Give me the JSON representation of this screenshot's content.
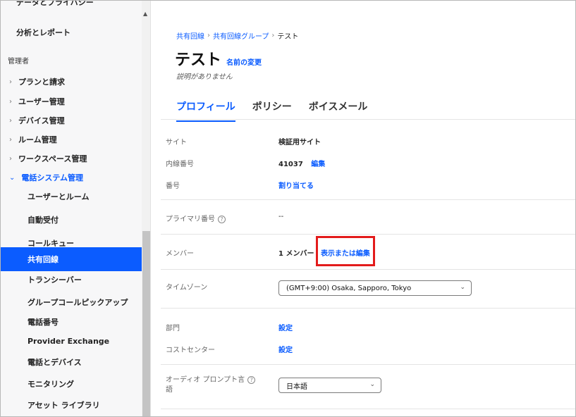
{
  "sidebar": {
    "cut_item": "データとプライバシー",
    "top_item": "分析とレポート",
    "section_label": "管理者",
    "items": [
      {
        "label": "プランと請求"
      },
      {
        "label": "ユーザー管理"
      },
      {
        "label": "デバイス管理"
      },
      {
        "label": "ルーム管理"
      },
      {
        "label": "ワークスペース管理"
      },
      {
        "label": "電話システム管理"
      }
    ],
    "subitems": [
      {
        "label": "ユーザーとルーム"
      },
      {
        "label": "自動受付"
      },
      {
        "label": "コールキュー"
      },
      {
        "label": "共有回線"
      },
      {
        "label": "トランシーバー"
      },
      {
        "label": "グループコールピックアップ"
      },
      {
        "label": "電話番号"
      },
      {
        "label": "Provider Exchange"
      },
      {
        "label": "電話とデバイス"
      },
      {
        "label": "モニタリング"
      },
      {
        "label": "アセット ライブラリ"
      }
    ],
    "chevron_closed": "›",
    "chevron_open": "⌄",
    "scroll_up": "▲"
  },
  "breadcrumb": {
    "items": [
      "共有回線",
      "共有回線グループ",
      "テスト"
    ],
    "separator": "›"
  },
  "page": {
    "title": "テスト",
    "rename_label": "名前の変更",
    "description": "説明がありません"
  },
  "tabs": [
    {
      "label": "プロフィール"
    },
    {
      "label": "ポリシー"
    },
    {
      "label": "ボイスメール"
    }
  ],
  "fields": {
    "site_label": "サイト",
    "site_value": "検証用サイト",
    "extension_label": "内線番号",
    "extension_value": "41037",
    "extension_edit": "編集",
    "number_label": "番号",
    "number_action": "割り当てる",
    "primary_label": "プライマリ番号",
    "primary_value": "--",
    "members_label": "メンバー",
    "members_value": "1 メンバー",
    "members_action": "表示または編集",
    "timezone_label": "タイムゾーン",
    "timezone_value": "(GMT+9:00) Osaka, Sapporo, Tokyo",
    "department_label": "部門",
    "department_action": "設定",
    "cost_center_label": "コストセンター",
    "cost_center_action": "設定",
    "audio_lang_label_line1": "オーディオ プロンプト言",
    "audio_lang_label_line2": "語",
    "audio_lang_value": "日本語",
    "help_glyph": "?",
    "caret_glyph": "⌄"
  },
  "colors": {
    "accent": "#0b5cff",
    "highlight": "#e31b1b"
  }
}
